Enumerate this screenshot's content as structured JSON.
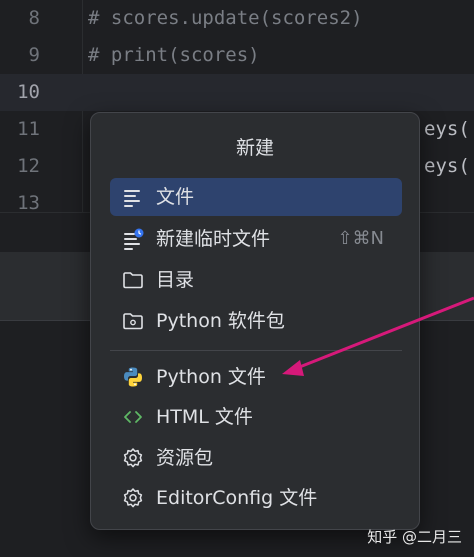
{
  "editor": {
    "lines": [
      {
        "num": "8",
        "code": "# scores.update(scores2)",
        "tail": ""
      },
      {
        "num": "9",
        "code": "# print(scores)",
        "tail": ""
      },
      {
        "num": "10",
        "code": "",
        "tail": ""
      },
      {
        "num": "11",
        "code": "",
        "tail": "eys("
      },
      {
        "num": "12",
        "code": "",
        "tail": "eys("
      },
      {
        "num": "13",
        "code": "",
        "tail": ""
      }
    ]
  },
  "popup": {
    "title": "新建",
    "items": [
      {
        "label": "文件",
        "icon": "text-file-icon",
        "shortcut": ""
      },
      {
        "label": "新建临时文件",
        "icon": "scratch-file-icon",
        "shortcut": "⇧⌘N"
      },
      {
        "label": "目录",
        "icon": "folder-icon",
        "shortcut": ""
      },
      {
        "label": "Python 软件包",
        "icon": "python-package-icon",
        "shortcut": ""
      },
      {
        "label": "Python 文件",
        "icon": "python-file-icon",
        "shortcut": ""
      },
      {
        "label": "HTML 文件",
        "icon": "html-file-icon",
        "shortcut": ""
      },
      {
        "label": "资源包",
        "icon": "gear-icon",
        "shortcut": ""
      },
      {
        "label": "EditorConfig 文件",
        "icon": "gear-icon",
        "shortcut": ""
      }
    ]
  },
  "watermark": "知乎 @二月三",
  "colors": {
    "background": "#1e1f22",
    "popup": "#2b2d30",
    "selected": "#2e436e",
    "arrow": "#d6197a",
    "python_blue": "#4b8bbe",
    "python_yellow": "#ffd43b",
    "html_green": "#5fb865",
    "badge_blue": "#3574f0"
  }
}
